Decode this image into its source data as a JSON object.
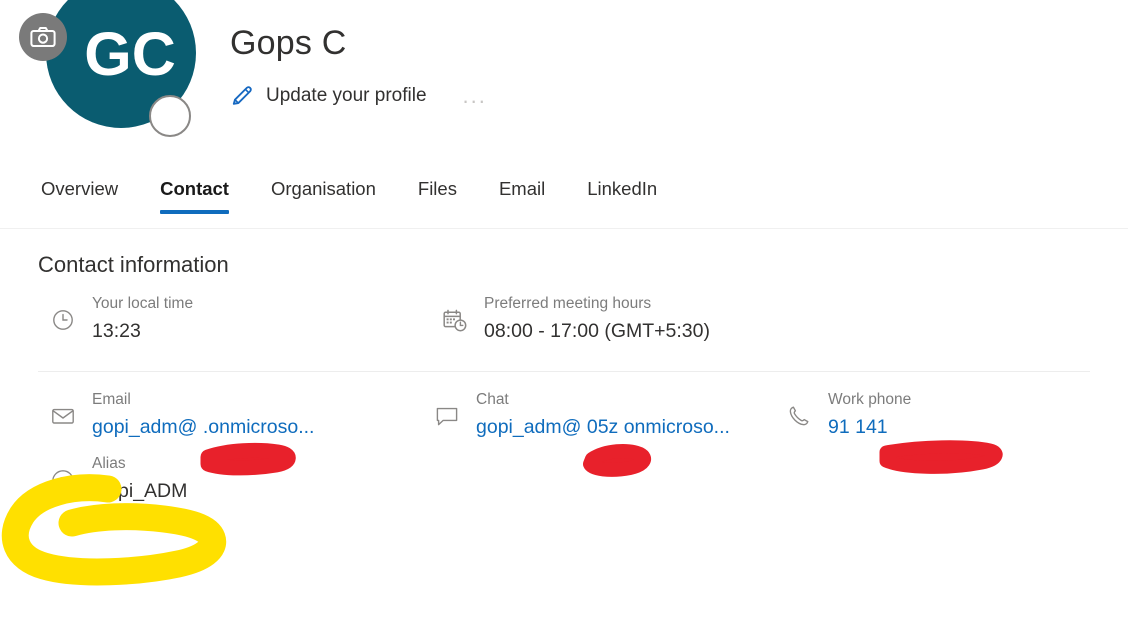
{
  "profile": {
    "initials": "GC",
    "display_name": "Gops C",
    "update_label": "Update your profile",
    "more_label": "...",
    "camera_icon": "camera-icon",
    "pencil_icon": "pencil-edit-icon",
    "presence_icon": "presence-status-ring",
    "avatar_color": "#0a5c70",
    "accent_color": "#0f6cbd"
  },
  "tabs": [
    {
      "label": "Overview",
      "active": false
    },
    {
      "label": "Contact",
      "active": true
    },
    {
      "label": "Organisation",
      "active": false
    },
    {
      "label": "Files",
      "active": false
    },
    {
      "label": "Email",
      "active": false
    },
    {
      "label": "LinkedIn",
      "active": false
    }
  ],
  "contact": {
    "section_title": "Contact information",
    "rows": [
      {
        "fields": [
          {
            "icon": "clock-icon",
            "label": "Your local time",
            "value": "13:23",
            "is_link": false
          },
          {
            "icon": "calendar-clock-icon",
            "label": "Preferred meeting hours",
            "value": "08:00 - 17:00 (GMT+5:30)",
            "is_link": false
          }
        ]
      },
      {
        "fields": [
          {
            "icon": "mail-icon",
            "label": "Email",
            "value": "gopi_adm@           .onmicroso...",
            "is_link": true
          },
          {
            "icon": "chat-bubble-icon",
            "label": "Chat",
            "value": "gopi_adm@    05z onmicroso...",
            "is_link": true
          },
          {
            "icon": "phone-icon",
            "label": "Work phone",
            "value": "91              141",
            "is_link": true
          }
        ]
      },
      {
        "fields": [
          {
            "icon": "at-sign-icon",
            "label": "Alias",
            "value": "Gopi_ADM",
            "is_link": false
          }
        ]
      }
    ]
  },
  "annotations": {
    "highlight_color": "#FFE000",
    "redaction_color": "#E8212B",
    "marks": [
      {
        "type": "redaction",
        "target": "email-value"
      },
      {
        "type": "redaction",
        "target": "chat-value"
      },
      {
        "type": "redaction",
        "target": "work-phone-value"
      },
      {
        "type": "highlight-loop",
        "target": "alias-field"
      }
    ]
  }
}
